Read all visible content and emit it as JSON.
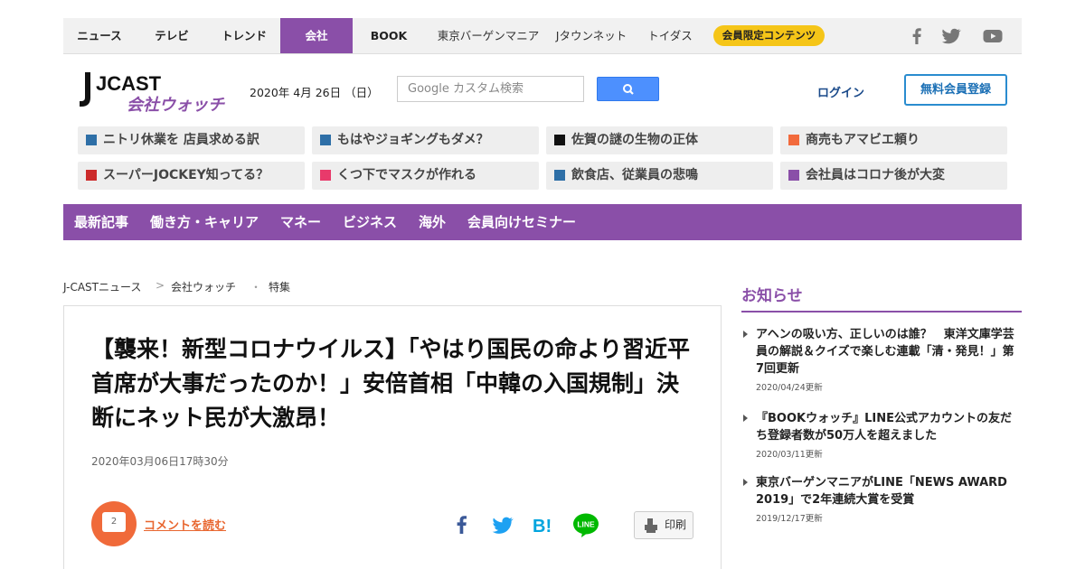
{
  "topnav": {
    "items": [
      "ニュース",
      "テレビ",
      "トレンド",
      "会社",
      "BOOK",
      "東京バーゲンマニア",
      "Jタウンネット",
      "トイダス"
    ],
    "member_label": "会員限定コンテンツ",
    "social": [
      "facebook-icon",
      "twitter-icon",
      "youtube-icon"
    ]
  },
  "header": {
    "logo_main": "JCAST",
    "logo_sub": "会社ウォッチ",
    "date": "2020年 4月 26日 （日）",
    "search_placeholder": "Google カスタム検索",
    "login": "ログイン",
    "register": "無料会員登録"
  },
  "trends": [
    {
      "label": "ニトリ休業を 店員求める訳",
      "color": "#2e6fa7"
    },
    {
      "label": "もはやジョギングもダメ？",
      "color": "#2e6fa7"
    },
    {
      "label": "佐賀の謎の生物の正体",
      "color": "#111111"
    },
    {
      "label": "商売もアマビエ頼り",
      "color": "#f26a3c"
    },
    {
      "label": "スーパーJOCKEY知ってる？",
      "color": "#cc2b2b"
    },
    {
      "label": "くつ下でマスクが作れる",
      "color": "#e83a6b"
    },
    {
      "label": "飲食店、従業員の悲鳴",
      "color": "#2e6fa7"
    },
    {
      "label": "会社員はコロナ後が大変",
      "color": "#8a4fa8"
    }
  ],
  "mainnav": [
    "最新記事",
    "働き方・キャリア",
    "マネー",
    "ビジネス",
    "海外",
    "会員向けセミナー"
  ],
  "breadcrumb": {
    "home": "J-CASTニュース",
    "sep1": ">",
    "section": "会社ウォッチ",
    "sep2": "・",
    "current": "特集"
  },
  "article": {
    "title": "【襲来！新型コロナウイルス】「やはり国民の命より習近平首席が大事だったのか！」安倍首相「中韓の入国規制」決断にネット民が大激昂！",
    "date": "2020年03月06日17時30分",
    "comment_count": "2",
    "comment_label": "コメントを読む",
    "print_label": "印刷"
  },
  "sidebar": {
    "title": "お知らせ",
    "news": [
      {
        "text": "アヘンの吸い方、正しいのは誰？　東洋文庫学芸員の解説＆クイズで楽しむ連載「清・発見！」第7回更新",
        "date": "2020/04/24更新"
      },
      {
        "text": "『BOOKウォッチ』LINE公式アカウントの友だち登録者数が50万人を超えました",
        "date": "2020/03/11更新"
      },
      {
        "text": "東京バーゲンマニアがLINE「NEWS AWARD 2019」で2年連続大賞を受賞",
        "date": "2019/12/17更新"
      }
    ]
  },
  "colors": {
    "brand": "#8a4fa8",
    "accent": "#f06a3a",
    "member": "#f5c518",
    "link": "#1a6fb5"
  }
}
